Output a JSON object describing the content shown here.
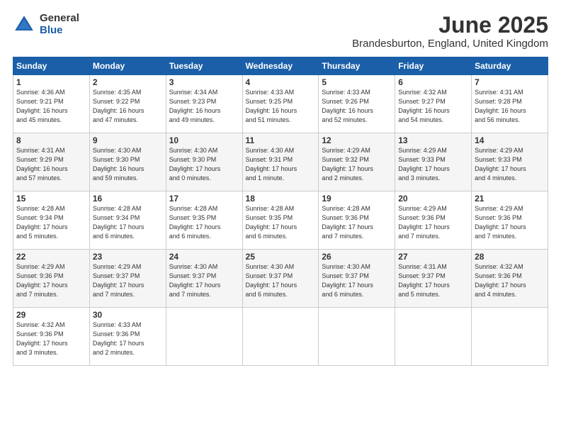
{
  "logo": {
    "general": "General",
    "blue": "Blue"
  },
  "title": "June 2025",
  "location": "Brandesburton, England, United Kingdom",
  "days_header": [
    "Sunday",
    "Monday",
    "Tuesday",
    "Wednesday",
    "Thursday",
    "Friday",
    "Saturday"
  ],
  "weeks": [
    [
      {
        "day": "1",
        "info": "Sunrise: 4:36 AM\nSunset: 9:21 PM\nDaylight: 16 hours\nand 45 minutes."
      },
      {
        "day": "2",
        "info": "Sunrise: 4:35 AM\nSunset: 9:22 PM\nDaylight: 16 hours\nand 47 minutes."
      },
      {
        "day": "3",
        "info": "Sunrise: 4:34 AM\nSunset: 9:23 PM\nDaylight: 16 hours\nand 49 minutes."
      },
      {
        "day": "4",
        "info": "Sunrise: 4:33 AM\nSunset: 9:25 PM\nDaylight: 16 hours\nand 51 minutes."
      },
      {
        "day": "5",
        "info": "Sunrise: 4:33 AM\nSunset: 9:26 PM\nDaylight: 16 hours\nand 52 minutes."
      },
      {
        "day": "6",
        "info": "Sunrise: 4:32 AM\nSunset: 9:27 PM\nDaylight: 16 hours\nand 54 minutes."
      },
      {
        "day": "7",
        "info": "Sunrise: 4:31 AM\nSunset: 9:28 PM\nDaylight: 16 hours\nand 56 minutes."
      }
    ],
    [
      {
        "day": "8",
        "info": "Sunrise: 4:31 AM\nSunset: 9:29 PM\nDaylight: 16 hours\nand 57 minutes."
      },
      {
        "day": "9",
        "info": "Sunrise: 4:30 AM\nSunset: 9:30 PM\nDaylight: 16 hours\nand 59 minutes."
      },
      {
        "day": "10",
        "info": "Sunrise: 4:30 AM\nSunset: 9:30 PM\nDaylight: 17 hours\nand 0 minutes."
      },
      {
        "day": "11",
        "info": "Sunrise: 4:30 AM\nSunset: 9:31 PM\nDaylight: 17 hours\nand 1 minute."
      },
      {
        "day": "12",
        "info": "Sunrise: 4:29 AM\nSunset: 9:32 PM\nDaylight: 17 hours\nand 2 minutes."
      },
      {
        "day": "13",
        "info": "Sunrise: 4:29 AM\nSunset: 9:33 PM\nDaylight: 17 hours\nand 3 minutes."
      },
      {
        "day": "14",
        "info": "Sunrise: 4:29 AM\nSunset: 9:33 PM\nDaylight: 17 hours\nand 4 minutes."
      }
    ],
    [
      {
        "day": "15",
        "info": "Sunrise: 4:28 AM\nSunset: 9:34 PM\nDaylight: 17 hours\nand 5 minutes."
      },
      {
        "day": "16",
        "info": "Sunrise: 4:28 AM\nSunset: 9:34 PM\nDaylight: 17 hours\nand 6 minutes."
      },
      {
        "day": "17",
        "info": "Sunrise: 4:28 AM\nSunset: 9:35 PM\nDaylight: 17 hours\nand 6 minutes."
      },
      {
        "day": "18",
        "info": "Sunrise: 4:28 AM\nSunset: 9:35 PM\nDaylight: 17 hours\nand 6 minutes."
      },
      {
        "day": "19",
        "info": "Sunrise: 4:28 AM\nSunset: 9:36 PM\nDaylight: 17 hours\nand 7 minutes."
      },
      {
        "day": "20",
        "info": "Sunrise: 4:29 AM\nSunset: 9:36 PM\nDaylight: 17 hours\nand 7 minutes."
      },
      {
        "day": "21",
        "info": "Sunrise: 4:29 AM\nSunset: 9:36 PM\nDaylight: 17 hours\nand 7 minutes."
      }
    ],
    [
      {
        "day": "22",
        "info": "Sunrise: 4:29 AM\nSunset: 9:36 PM\nDaylight: 17 hours\nand 7 minutes."
      },
      {
        "day": "23",
        "info": "Sunrise: 4:29 AM\nSunset: 9:37 PM\nDaylight: 17 hours\nand 7 minutes."
      },
      {
        "day": "24",
        "info": "Sunrise: 4:30 AM\nSunset: 9:37 PM\nDaylight: 17 hours\nand 7 minutes."
      },
      {
        "day": "25",
        "info": "Sunrise: 4:30 AM\nSunset: 9:37 PM\nDaylight: 17 hours\nand 6 minutes."
      },
      {
        "day": "26",
        "info": "Sunrise: 4:30 AM\nSunset: 9:37 PM\nDaylight: 17 hours\nand 6 minutes."
      },
      {
        "day": "27",
        "info": "Sunrise: 4:31 AM\nSunset: 9:37 PM\nDaylight: 17 hours\nand 5 minutes."
      },
      {
        "day": "28",
        "info": "Sunrise: 4:32 AM\nSunset: 9:36 PM\nDaylight: 17 hours\nand 4 minutes."
      }
    ],
    [
      {
        "day": "29",
        "info": "Sunrise: 4:32 AM\nSunset: 9:36 PM\nDaylight: 17 hours\nand 3 minutes."
      },
      {
        "day": "30",
        "info": "Sunrise: 4:33 AM\nSunset: 9:36 PM\nDaylight: 17 hours\nand 2 minutes."
      },
      {
        "day": "",
        "info": ""
      },
      {
        "day": "",
        "info": ""
      },
      {
        "day": "",
        "info": ""
      },
      {
        "day": "",
        "info": ""
      },
      {
        "day": "",
        "info": ""
      }
    ]
  ]
}
